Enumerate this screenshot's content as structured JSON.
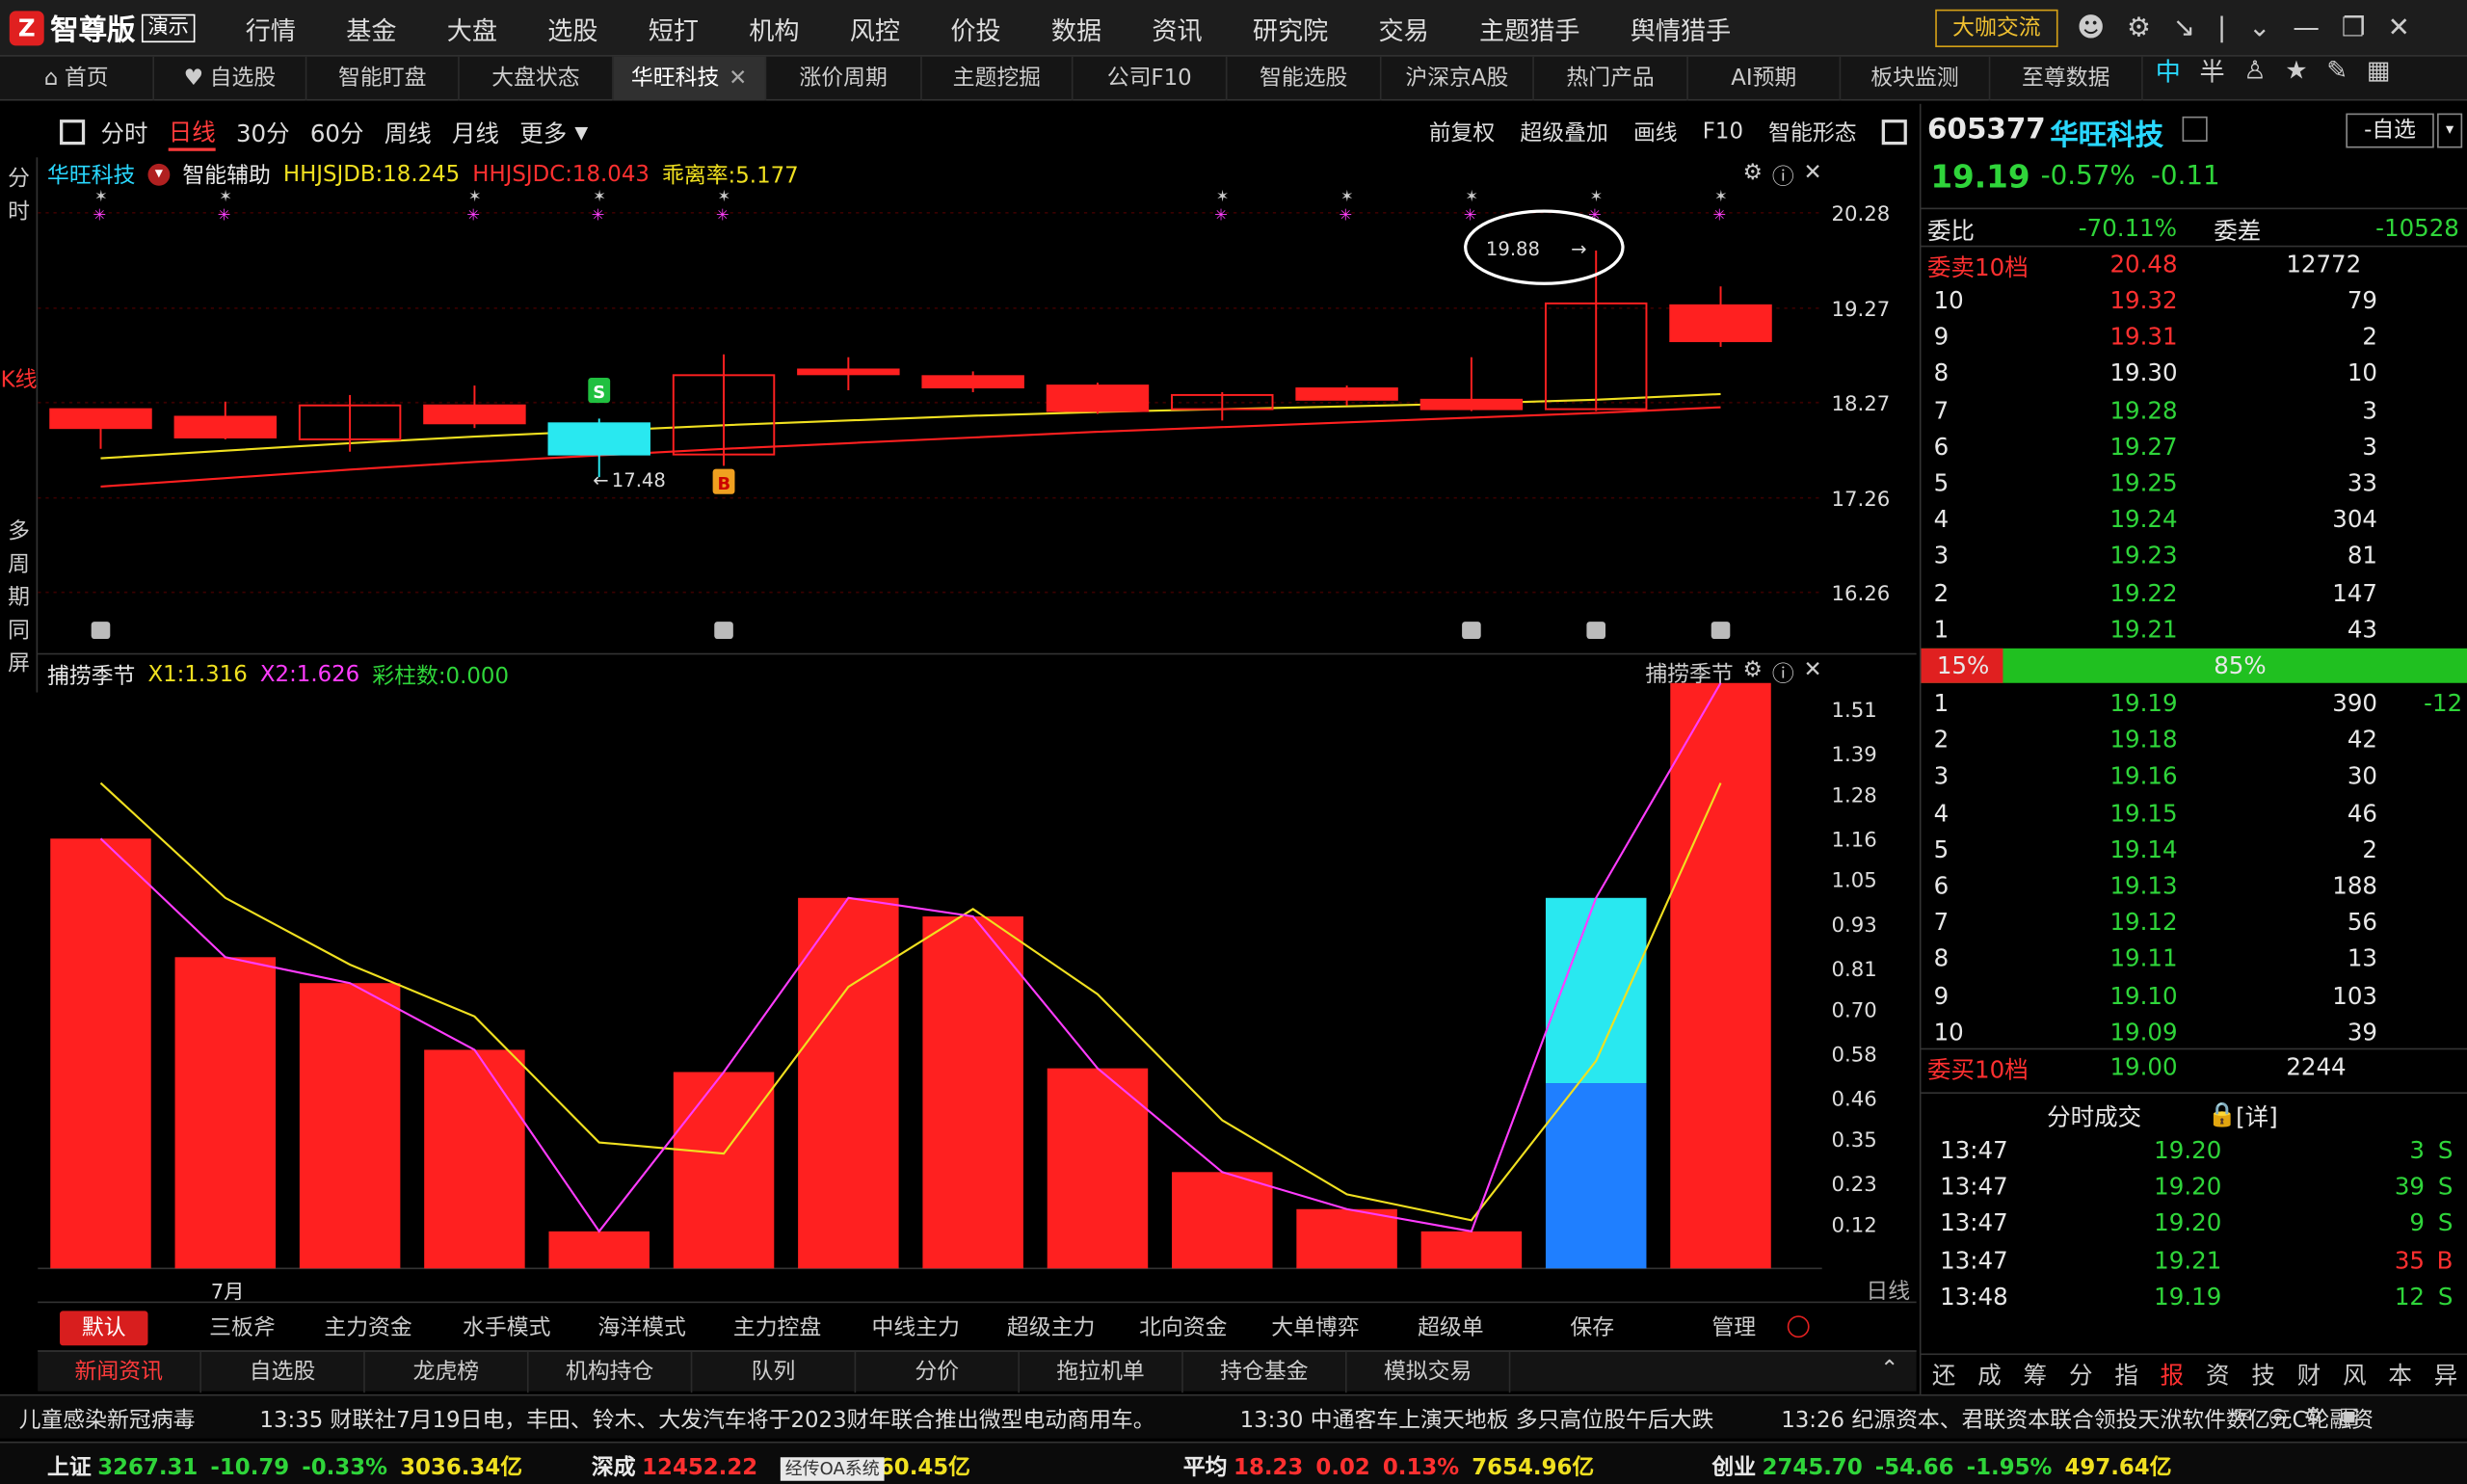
{
  "app": {
    "brand": "智尊版",
    "badge": "演示"
  },
  "menu": [
    "行情",
    "基金",
    "大盘",
    "选股",
    "短打",
    "机构",
    "风控",
    "价投",
    "数据",
    "资讯",
    "研究院",
    "交易",
    "主题猎手",
    "舆情猎手"
  ],
  "top_right": {
    "talk_button": "大咖交流"
  },
  "tabs": [
    {
      "label": "首页",
      "icon": "home-icon"
    },
    {
      "label": "自选股",
      "icon": "heart-icon"
    },
    {
      "label": "智能盯盘"
    },
    {
      "label": "大盘状态"
    },
    {
      "label": "华旺科技",
      "active": true,
      "closable": true
    },
    {
      "label": "涨价周期"
    },
    {
      "label": "主题挖掘"
    },
    {
      "label": "公司F10"
    },
    {
      "label": "智能选股"
    },
    {
      "label": "沪深京A股"
    },
    {
      "label": "热门产品"
    },
    {
      "label": "AI预期"
    },
    {
      "label": "板块监测"
    },
    {
      "label": "至尊数据"
    }
  ],
  "tab_right": {
    "ime": "中",
    "ime2": "半"
  },
  "periods": [
    "分时",
    "日线",
    "30分",
    "60分",
    "周线",
    "月线",
    "更多"
  ],
  "active_period": "日线",
  "period_right": [
    "前复权",
    "超级叠加",
    "画线",
    "F10",
    "智能形态"
  ],
  "vtabs": {
    "fenshi": "分时",
    "kline": "K线",
    "multi": "多周期同屏"
  },
  "kline": {
    "stock_name": "华旺科技",
    "assist": "智能辅助",
    "hhjsjdb": "HHJSJDB:18.245",
    "hhjsjdc": "HHJSJDC:18.043",
    "deviation": "乖离率:5.177",
    "price_labels": [
      "20.28",
      "19.27",
      "18.27",
      "17.26",
      "16.26"
    ],
    "ymin": 15.9,
    "ymax": 20.6,
    "candles": [
      {
        "o": 18.2,
        "c": 18.0,
        "h": 18.2,
        "l": 17.78,
        "fill": "solid"
      },
      {
        "o": 18.12,
        "c": 17.9,
        "h": 18.28,
        "l": 17.88,
        "fill": "solid"
      },
      {
        "o": 17.88,
        "c": 18.24,
        "h": 18.35,
        "l": 17.75,
        "fill": "hollow"
      },
      {
        "o": 18.24,
        "c": 18.05,
        "h": 18.45,
        "l": 18.0,
        "fill": "solid"
      },
      {
        "o": 18.05,
        "c": 17.72,
        "h": 18.1,
        "l": 17.48,
        "fill": "cyan"
      },
      {
        "o": 17.72,
        "c": 18.56,
        "h": 18.78,
        "l": 17.6,
        "fill": "hollow"
      },
      {
        "o": 18.62,
        "c": 18.57,
        "h": 18.75,
        "l": 18.4,
        "fill": "solid"
      },
      {
        "o": 18.55,
        "c": 18.43,
        "h": 18.6,
        "l": 18.38,
        "fill": "solid"
      },
      {
        "o": 18.45,
        "c": 18.18,
        "h": 18.48,
        "l": 18.15,
        "fill": "solid"
      },
      {
        "o": 18.2,
        "c": 18.35,
        "h": 18.38,
        "l": 18.08,
        "fill": "hollow"
      },
      {
        "o": 18.42,
        "c": 18.3,
        "h": 18.45,
        "l": 18.24,
        "fill": "solid"
      },
      {
        "o": 18.3,
        "c": 18.2,
        "h": 18.75,
        "l": 18.18,
        "fill": "solid"
      },
      {
        "o": 18.2,
        "c": 19.32,
        "h": 19.88,
        "l": 18.18,
        "fill": "hollow"
      },
      {
        "o": 19.3,
        "c": 18.92,
        "h": 19.5,
        "l": 18.86,
        "fill": "solid"
      }
    ],
    "yellow_line": [
      17.68,
      17.76,
      17.84,
      17.91,
      17.97,
      18.03,
      18.08,
      18.13,
      18.17,
      18.2,
      18.23,
      18.26,
      18.3,
      18.36
    ],
    "red_line": [
      17.38,
      17.47,
      17.56,
      17.64,
      17.71,
      17.78,
      17.84,
      17.9,
      17.96,
      18.01,
      18.06,
      18.11,
      18.16,
      18.22
    ],
    "star_columns": [
      0,
      1,
      3,
      4,
      5,
      9,
      10,
      11,
      12,
      13
    ],
    "annotations": {
      "high_label": "19.88",
      "low_label": "17.48",
      "s_marker": "S",
      "b_marker": "B"
    }
  },
  "indicator": {
    "name": "捕捞季节",
    "x1": "X1:1.316",
    "x2": "X2:1.626",
    "caizhu": "彩柱数:0.000",
    "name_right": "捕捞季节",
    "y_labels": [
      "1.51",
      "1.39",
      "1.28",
      "1.16",
      "1.05",
      "0.93",
      "0.81",
      "0.70",
      "0.58",
      "0.46",
      "0.35",
      "0.23",
      "0.12"
    ],
    "ymax": 1.58,
    "bars": [
      1.16,
      0.84,
      0.77,
      0.59,
      0.1,
      0.53,
      1.0,
      0.95,
      0.54,
      0.26,
      0.16,
      0.1,
      1.0,
      1.58
    ],
    "bar_split": {
      "index": 12,
      "lower": 0.5
    },
    "yellow": [
      1.31,
      1.0,
      0.82,
      0.68,
      0.34,
      0.31,
      0.76,
      0.97,
      0.74,
      0.4,
      0.2,
      0.13,
      0.56,
      1.31
    ],
    "magenta": [
      1.16,
      0.84,
      0.77,
      0.59,
      0.1,
      0.53,
      1.0,
      0.95,
      0.54,
      0.26,
      0.16,
      0.1,
      1.0,
      1.58
    ],
    "month_label": "7月",
    "period_label": "日线"
  },
  "indicators": [
    "默认",
    "三板斧",
    "主力资金",
    "水手模式",
    "海洋模式",
    "主力控盘",
    "中线主力",
    "超级主力",
    "北向资金",
    "大单博弈",
    "超级单",
    "保存",
    "管理"
  ],
  "bottom_tabs": [
    "新闻资讯",
    "自选股",
    "龙虎榜",
    "机构持仓",
    "队列",
    "分价",
    "拖拉机单",
    "持仓基金",
    "模拟交易"
  ],
  "news": [
    "儿童感染新冠病毒",
    "13:35 财联社7月19日电，丰田、铃木、大发汽车将于2023财年联合推出微型电动商用车。",
    "13:30 中通客车上演天地板 多只高位股午后大跌",
    "13:26 纪源资本、君联资本联合领投天洑软件数亿元C轮融资"
  ],
  "indices": [
    {
      "name": "上证",
      "value": "3267.31",
      "change": "-10.79",
      "pct": "-0.33%",
      "amount": "3036.34亿"
    },
    {
      "name": "深成",
      "value": "12452.22",
      "change": "",
      "pct": "64%",
      "amount": "4660.45亿"
    },
    {
      "name": "平均",
      "value": "18.23",
      "change": "0.02",
      "pct": "0.13%",
      "amount": "7654.96亿"
    },
    {
      "name": "创业",
      "value": "2745.70",
      "change": "-54.66",
      "pct": "-1.95%",
      "amount": "497.64亿"
    }
  ],
  "oa_label": "经传OA系统",
  "quote": {
    "code": "605377",
    "name": "华旺科技",
    "fav_button": "-自选",
    "price": "19.19",
    "pct": "-0.57%",
    "change": "-0.11",
    "weibi_label": "委比",
    "weibi": "-70.11%",
    "weicha_label": "委差",
    "weicha": "-10528",
    "sell_label": "委卖10档",
    "sell_price": "20.48",
    "sell_vol": "12772",
    "asks": [
      {
        "n": "10",
        "p": "19.32",
        "v": "79",
        "c": "rd"
      },
      {
        "n": "9",
        "p": "19.31",
        "v": "2",
        "c": "rd"
      },
      {
        "n": "8",
        "p": "19.30",
        "v": "10",
        "c": "wh"
      },
      {
        "n": "7",
        "p": "19.28",
        "v": "3",
        "c": "gr"
      },
      {
        "n": "6",
        "p": "19.27",
        "v": "3",
        "c": "gr"
      },
      {
        "n": "5",
        "p": "19.25",
        "v": "33",
        "c": "gr"
      },
      {
        "n": "4",
        "p": "19.24",
        "v": "304",
        "c": "gr"
      },
      {
        "n": "3",
        "p": "19.23",
        "v": "81",
        "c": "gr"
      },
      {
        "n": "2",
        "p": "19.22",
        "v": "147",
        "c": "gr"
      },
      {
        "n": "1",
        "p": "19.21",
        "v": "43",
        "c": "gr"
      }
    ],
    "ratio_left": "15%",
    "ratio_right": "85%",
    "ratio_left_frac": 0.15,
    "bids": [
      {
        "n": "1",
        "p": "19.19",
        "v": "390",
        "x": "-12"
      },
      {
        "n": "2",
        "p": "19.18",
        "v": "42"
      },
      {
        "n": "3",
        "p": "19.16",
        "v": "30"
      },
      {
        "n": "4",
        "p": "19.15",
        "v": "46"
      },
      {
        "n": "5",
        "p": "19.14",
        "v": "2"
      },
      {
        "n": "6",
        "p": "19.13",
        "v": "188"
      },
      {
        "n": "7",
        "p": "19.12",
        "v": "56"
      },
      {
        "n": "8",
        "p": "19.11",
        "v": "13"
      },
      {
        "n": "9",
        "p": "19.10",
        "v": "103"
      },
      {
        "n": "10",
        "p": "19.09",
        "v": "39"
      }
    ],
    "buy_label": "委买10档",
    "buy_price": "19.00",
    "buy_vol": "2244",
    "trades_label": "分时成交",
    "trades_detail": "[详]",
    "trades": [
      {
        "t": "13:47",
        "p": "19.20",
        "v": "3",
        "s": "S"
      },
      {
        "t": "13:47",
        "p": "19.20",
        "v": "39",
        "s": "S"
      },
      {
        "t": "13:47",
        "p": "19.20",
        "v": "9",
        "s": "S"
      },
      {
        "t": "13:47",
        "p": "19.21",
        "v": "35",
        "s": "B"
      },
      {
        "t": "13:48",
        "p": "19.19",
        "v": "12",
        "s": "S"
      }
    ],
    "right_tabs": [
      "还",
      "成",
      "筹",
      "分",
      "指",
      "报",
      "资",
      "技",
      "财",
      "风",
      "本",
      "异"
    ],
    "right_tab_active": "报"
  },
  "colors": {
    "up": "#ff2020",
    "down": "#2fd53a",
    "cyan": "#29e8f0",
    "blue": "#1f7fff",
    "yellow": "#f0e020",
    "magenta": "#ff3cff"
  }
}
